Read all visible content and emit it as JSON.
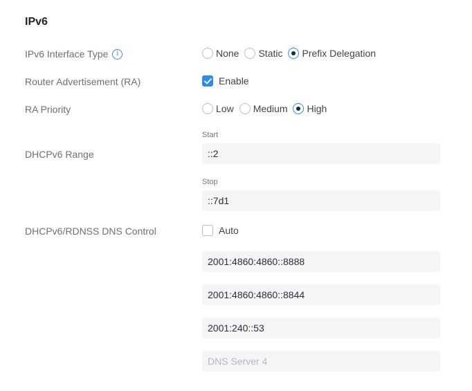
{
  "section": {
    "title": "IPv6"
  },
  "ipv6_interface_type": {
    "label": "IPv6 Interface Type",
    "info_icon_glyph": "i",
    "options": [
      "None",
      "Static",
      "Prefix Delegation"
    ],
    "selected": "Prefix Delegation"
  },
  "router_advertisement": {
    "label": "Router Advertisement (RA)",
    "checkbox_label": "Enable",
    "checked": true
  },
  "ra_priority": {
    "label": "RA Priority",
    "options": [
      "Low",
      "Medium",
      "High"
    ],
    "selected": "High"
  },
  "dhcpv6_range": {
    "label": "DHCPv6 Range",
    "start_label": "Start",
    "start_value": "::2",
    "stop_label": "Stop",
    "stop_value": "::7d1"
  },
  "dns_control": {
    "label": "DHCPv6/RDNSS DNS Control",
    "checkbox_label": "Auto",
    "checked": false,
    "servers": [
      {
        "value": "2001:4860:4860::8888",
        "placeholder": ""
      },
      {
        "value": "2001:4860:4860::8844",
        "placeholder": ""
      },
      {
        "value": "2001:240::53",
        "placeholder": ""
      },
      {
        "value": "",
        "placeholder": "DNS Server 4"
      }
    ]
  },
  "colors": {
    "accent": "#2d8cf0",
    "radio_dot": "#1d2a3a",
    "input_bg": "#f4f5f6",
    "label_text": "#6b7078"
  }
}
